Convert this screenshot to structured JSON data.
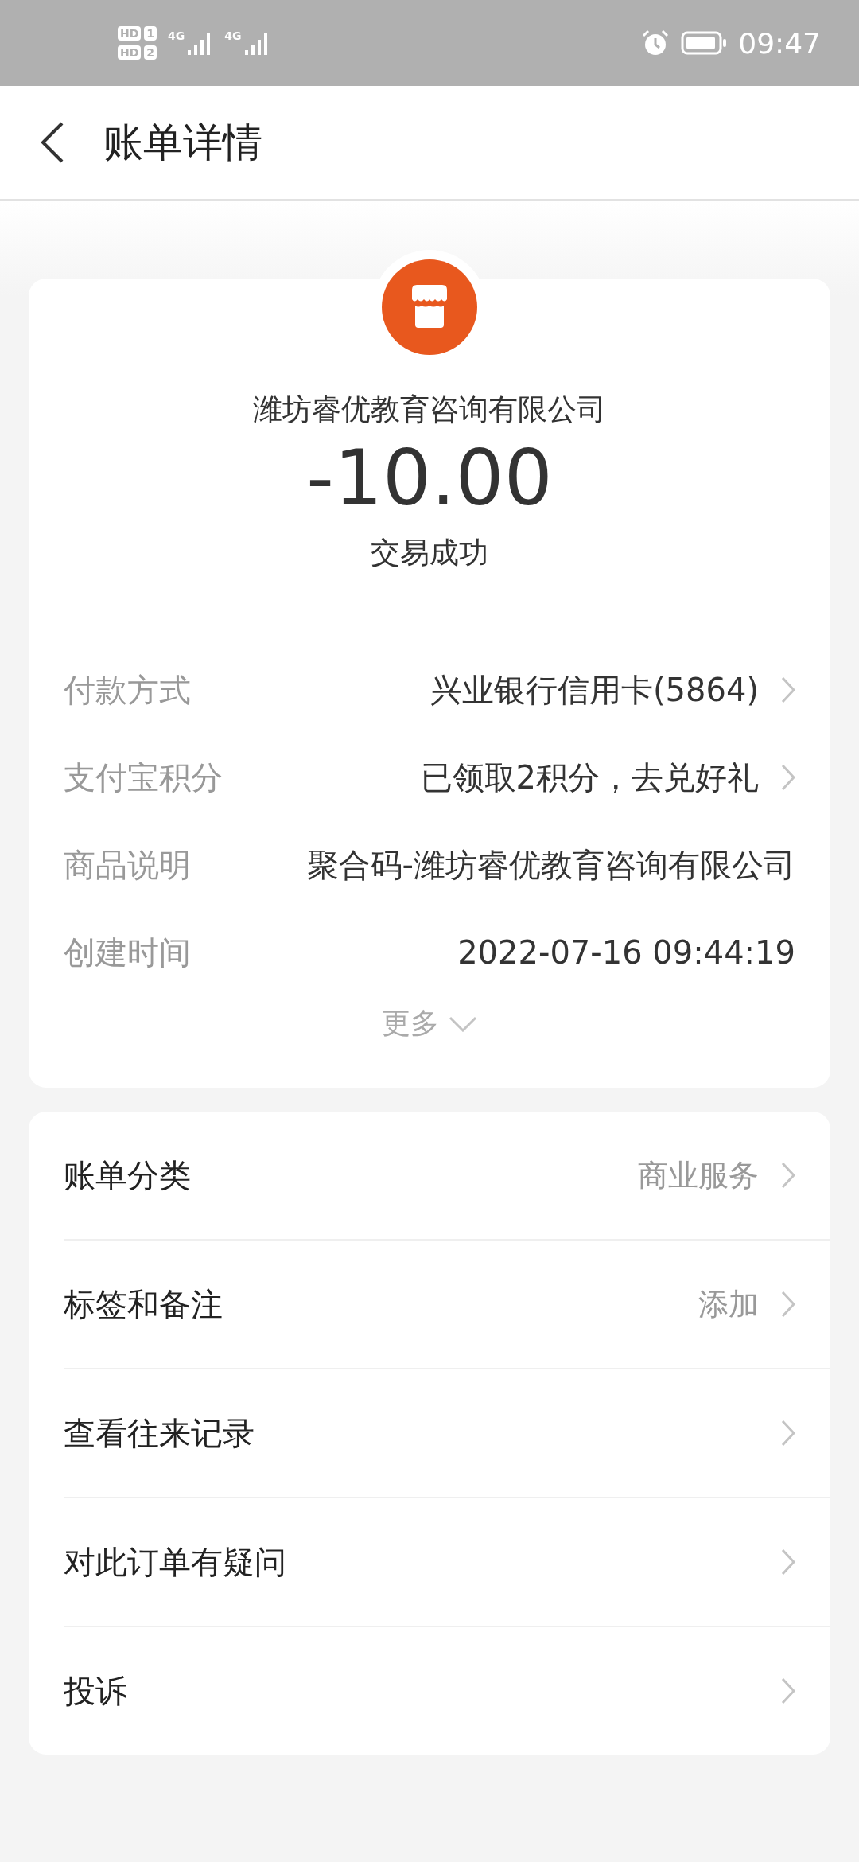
{
  "status_bar": {
    "sim_badges": [
      {
        "label": "HD",
        "slot": "1"
      },
      {
        "label": "HD",
        "slot": "2"
      }
    ],
    "networks": [
      "4G",
      "4G"
    ],
    "time": "09:47"
  },
  "header": {
    "title": "账单详情"
  },
  "summary": {
    "merchant": "潍坊睿优教育咨询有限公司",
    "amount": "-10.00",
    "status": "交易成功"
  },
  "details": [
    {
      "label": "付款方式",
      "value": "兴业银行信用卡(5864)",
      "has_arrow": true
    },
    {
      "label": "支付宝积分",
      "value": "已领取2积分，去兑好礼",
      "has_arrow": true
    },
    {
      "label": "商品说明",
      "value": "聚合码-潍坊睿优教育咨询有限公司",
      "has_arrow": false
    },
    {
      "label": "创建时间",
      "value": "2022-07-16 09:44:19",
      "has_arrow": false
    }
  ],
  "more": {
    "label": "更多"
  },
  "menu": [
    {
      "label": "账单分类",
      "value": "商业服务"
    },
    {
      "label": "标签和备注",
      "value": "添加"
    },
    {
      "label": "查看往来记录"
    },
    {
      "label": "对此订单有疑问"
    },
    {
      "label": "投诉"
    }
  ]
}
